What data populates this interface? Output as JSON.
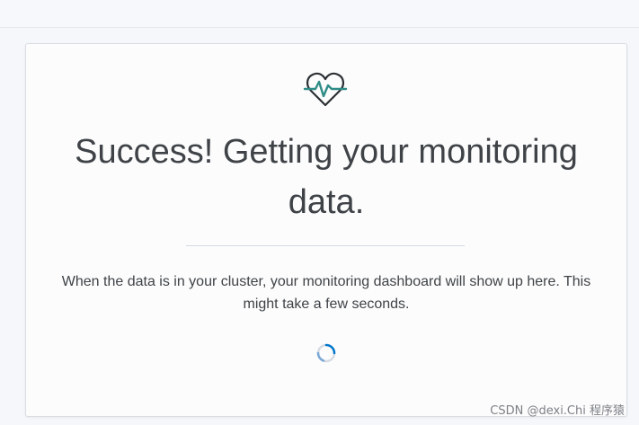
{
  "header": {},
  "panel": {
    "icon": "heartbeat-icon",
    "title": "Success! Getting your monitoring data.",
    "message": "When the data is in your cluster, your monitoring dashboard will show up here. This might take a few seconds.",
    "loading_icon": "loading-spinner-icon"
  },
  "watermark": {
    "text": "CSDN @dexi.Chi 程序猿"
  },
  "colors": {
    "icon_teal": "#2f8c86",
    "icon_dark": "#2b2f33",
    "text": "#3f4347",
    "divider": "#d3dae6",
    "spinner_blue": "#0077cc"
  }
}
